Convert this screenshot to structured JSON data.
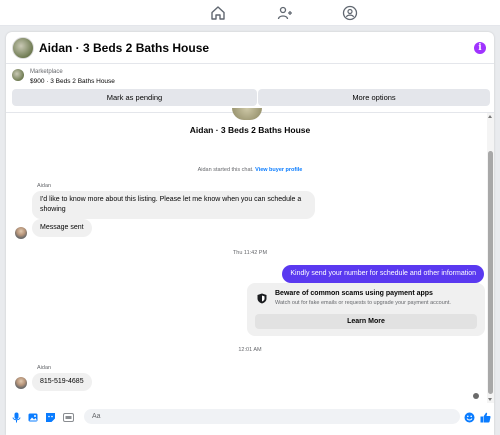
{
  "topnav": {
    "icons": [
      "home-icon",
      "people-icon",
      "groups-icon"
    ]
  },
  "header": {
    "title": "Aidan · 3 Beds 2 Baths House",
    "info_icon": "i",
    "accent": "#a033ff"
  },
  "listing": {
    "source": "Marketplace",
    "price_title": "$900 · 3 Beds 2 Baths House"
  },
  "actions": {
    "mark_pending": "Mark as pending",
    "more_options": "More options"
  },
  "chat": {
    "title": "Aidan · 3 Beds 2 Baths House",
    "started_text": "Aidan started this chat.",
    "view_profile": "View buyer profile"
  },
  "messages": {
    "sender1": "Aidan",
    "msg1": "I'd like to know more about this listing. Please let me know when you can schedule a showing",
    "msg2": "Message sent",
    "time1": "Thu 11:42 PM",
    "outgoing": "Kindly send your number for schedule and other information",
    "outgoing_color": "#5a39f0",
    "scam_title": "Beware of common scams using payment apps",
    "scam_desc": "Watch out for fake emails or requests to upgrade your payment account.",
    "learn_more": "Learn More",
    "time2": "12:01 AM",
    "sender2": "Aidan",
    "msg3": "815-519-4685"
  },
  "composer": {
    "placeholder": "Aa",
    "icons": [
      "mic-icon",
      "image-icon",
      "sticker-icon",
      "gif-icon",
      "emoji-icon",
      "like-icon"
    ],
    "accent": "#0a7cff"
  }
}
